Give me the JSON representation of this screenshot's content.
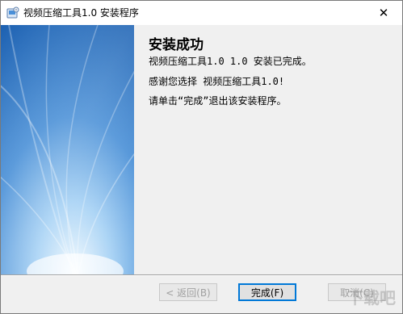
{
  "window": {
    "title": "视频压缩工具1.0 安装程序",
    "close_glyph": "✕"
  },
  "content": {
    "heading": "安装成功",
    "line1": "视频压缩工具1.0 1.0 安装已完成。",
    "line2": "感谢您选择 视频压缩工具1.0!",
    "line3": "请单击“完成”退出该安装程序。"
  },
  "buttons": {
    "back": "< 返回(B)",
    "finish": "完成(F)",
    "cancel": "取消(C)"
  },
  "colors": {
    "banner_dark": "#1b5fb0",
    "banner_light": "#dff0ff",
    "accent": "#0078d7"
  },
  "icons": {
    "app": "installer-app-icon",
    "close": "close-icon"
  },
  "watermark": "下载吧"
}
